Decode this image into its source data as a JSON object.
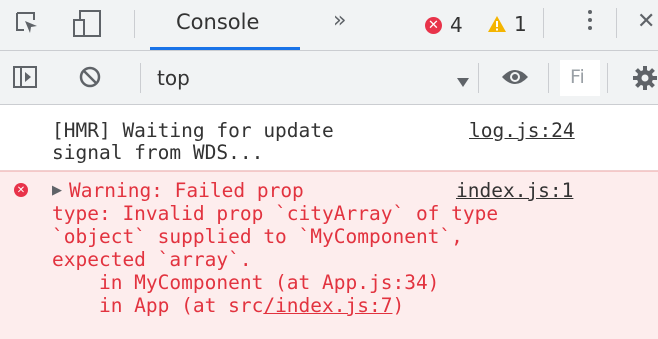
{
  "toolbar": {
    "active_tab": "Console",
    "more_tabs": "»",
    "error_count": "4",
    "warning_count": "1",
    "close": "✕"
  },
  "console_bar": {
    "context": "top",
    "filter_placeholder": "Fi"
  },
  "messages": {
    "log": {
      "line1": "[HMR] Waiting for update",
      "line2": "signal from WDS...",
      "source": "log.js:24"
    },
    "warning": {
      "expand": "▶",
      "line1": "Warning: Failed prop",
      "source": "index.js:1",
      "line2": "type: Invalid prop `cityArray` of type",
      "line3": "`object` supplied to `MyComponent`,",
      "line4": "expected `array`.",
      "stack1": "    in MyComponent (at App.js:34)",
      "stack2_prefix": "    in App (at src",
      "stack2_link": "/index.js:7",
      "stack2_suffix": ")"
    }
  },
  "colors": {
    "error": "#e8334a",
    "warning": "#f4b400",
    "accent": "#1a73e8",
    "warning_bg": "#fdeded"
  }
}
